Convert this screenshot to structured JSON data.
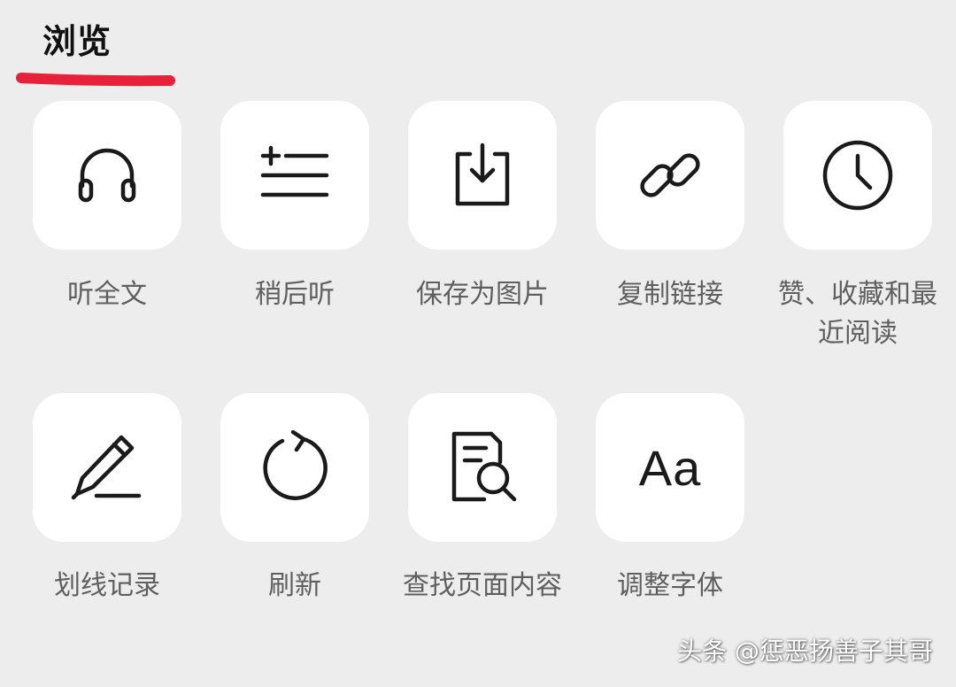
{
  "section": {
    "title": "浏览",
    "underline_color": "#e8203a"
  },
  "items": [
    {
      "label": "听全文",
      "icon": "headphones-icon"
    },
    {
      "label": "稍后听",
      "icon": "add-to-playlist-icon"
    },
    {
      "label": "保存为图片",
      "icon": "download-to-tray-icon"
    },
    {
      "label": "复制链接",
      "icon": "link-icon"
    },
    {
      "label": "赞、收藏和最近阅读",
      "icon": "clock-icon"
    },
    {
      "label": "划线记录",
      "icon": "pen-underline-icon"
    },
    {
      "label": "刷新",
      "icon": "refresh-icon"
    },
    {
      "label": "查找页面内容",
      "icon": "document-search-icon"
    },
    {
      "label": "调整字体",
      "icon": "font-size-icon",
      "glyph": "Aa"
    }
  ],
  "watermark": "头条 @惩恶扬善子其哥",
  "colors": {
    "background": "#ededed",
    "tile": "#ffffff",
    "icon_stroke": "#1a1a1a",
    "label": "#5f5f5f"
  }
}
